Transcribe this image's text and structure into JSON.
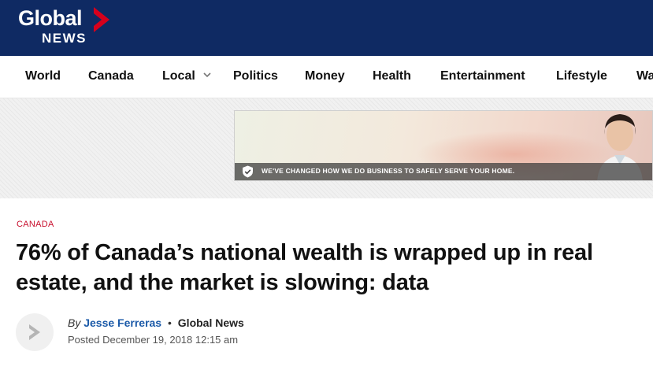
{
  "header": {
    "logo_line1": "Global",
    "logo_line2": "NEWS",
    "logo_icon": "global-news-red-chevron",
    "background_color": "#0f2a63",
    "accent_color": "#d6001c"
  },
  "nav": {
    "items": [
      {
        "label": "World"
      },
      {
        "label": "Canada"
      },
      {
        "label": "Local",
        "has_dropdown": true
      },
      {
        "label": "Politics"
      },
      {
        "label": "Money"
      },
      {
        "label": "Health"
      },
      {
        "label": "Entertainment"
      },
      {
        "label": "Lifestyle"
      },
      {
        "label": "Wa"
      }
    ]
  },
  "ad": {
    "banner_text": "WE'VE CHANGED HOW WE DO BUSINESS TO SAFELY SERVE YOUR HOME.",
    "icon": "shield-check-icon"
  },
  "article": {
    "category": "CANADA",
    "category_color": "#c8102e",
    "headline": "76% of Canada’s national wealth is wrapped up in real estate, and the market is slowing: data",
    "byline_prefix": "By",
    "author": "Jesse Ferreras",
    "separator": "•",
    "source": "Global News",
    "posted": "Posted December 19, 2018 12:15 am",
    "avatar_icon": "global-news-avatar-icon"
  }
}
